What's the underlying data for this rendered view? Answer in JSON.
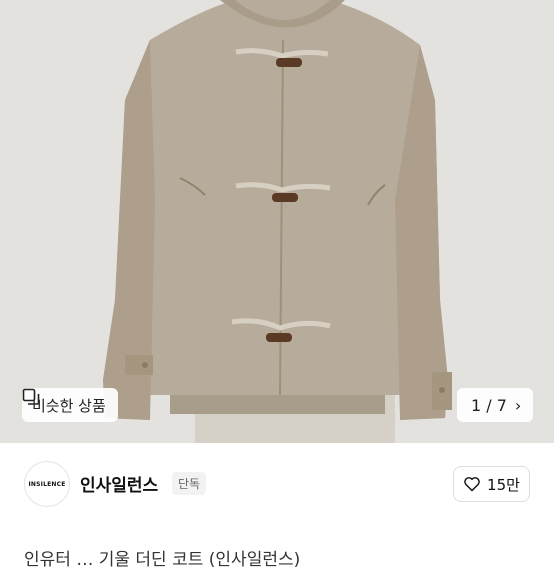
{
  "hero": {
    "image_alt": "Beige wool duffle coat product photo"
  },
  "similar_button": {
    "label": "비슷한 상품",
    "icon": "similar-items-icon"
  },
  "image_counter": {
    "text": "1 / 7",
    "icon": "chevron-right-icon"
  },
  "shop": {
    "logo_text": "INSILENCE",
    "name": "인사일런스",
    "badge": "단독"
  },
  "like": {
    "count": "15만",
    "icon": "heart-outline-icon"
  },
  "product": {
    "title": "인유터 … 기울 더딘 코트 (인사일런스)"
  }
}
